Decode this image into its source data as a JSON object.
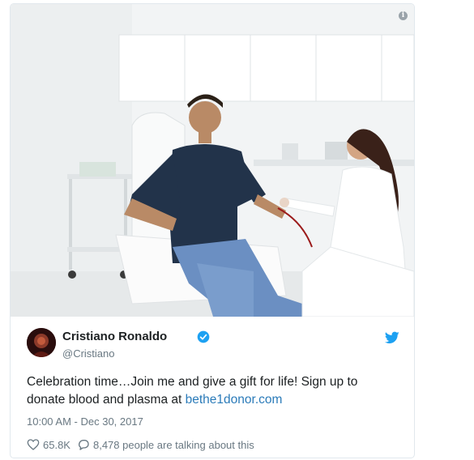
{
  "tweet": {
    "author_name": "Cristiano Ronaldo",
    "handle": "@Cristiano",
    "text_before_link": "Celebration time…Join me and give a gift for life! Sign up to donate blood and plasma at ",
    "link_text": "bethe1donor.com",
    "timestamp": "10:00 AM - Dec 30, 2017",
    "likes": "65.8K",
    "replies_text": "8,478 people are talking about this"
  },
  "colors": {
    "link": "#2b7bb9",
    "verified": "#1da1f2",
    "muted": "#697882",
    "text": "#1c2022"
  },
  "icons": [
    "info-icon",
    "verified-icon",
    "twitter-bird-icon",
    "heart-icon",
    "reply-icon"
  ]
}
